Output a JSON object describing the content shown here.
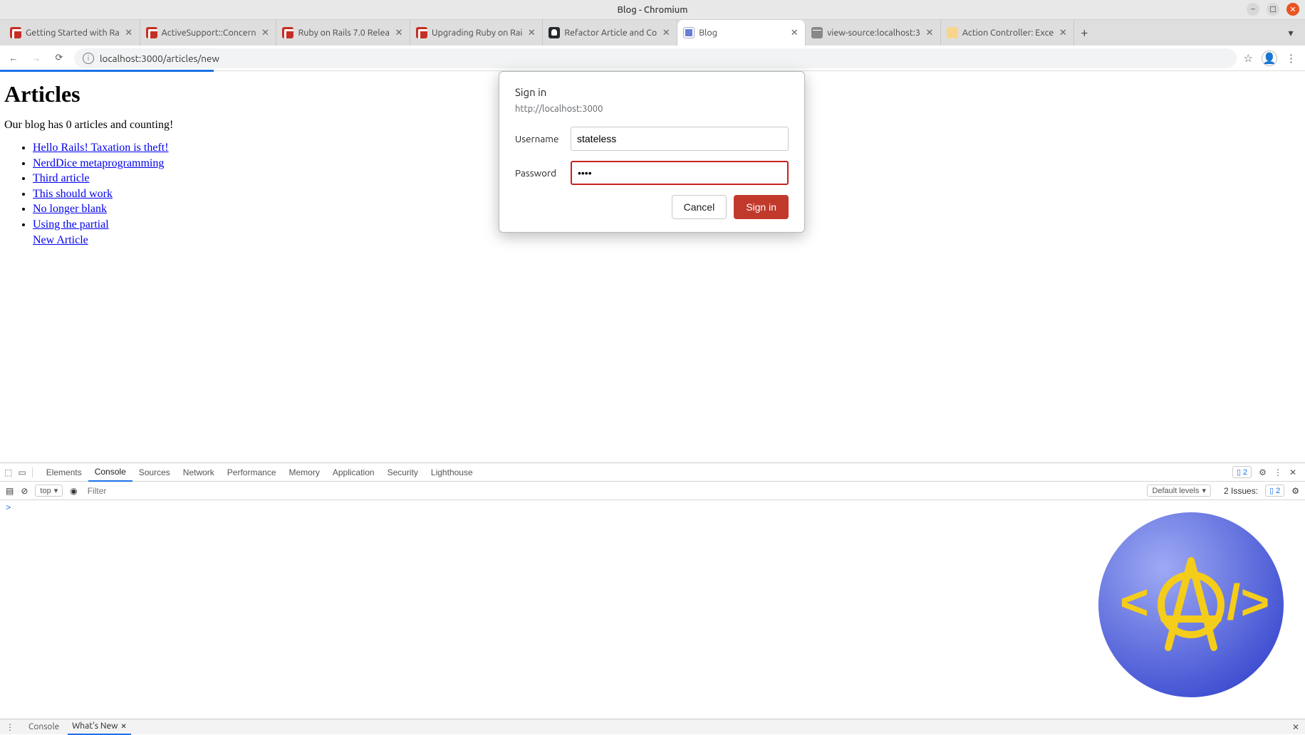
{
  "os": {
    "title": "Blog - Chromium"
  },
  "tabs": [
    {
      "title": "Getting Started with Ra",
      "favicon": "rails"
    },
    {
      "title": "ActiveSupport::Concern",
      "favicon": "rails"
    },
    {
      "title": "Ruby on Rails 7.0 Relea",
      "favicon": "rails"
    },
    {
      "title": "Upgrading Ruby on Rai",
      "favicon": "rails"
    },
    {
      "title": "Refactor Article and Co",
      "favicon": "github"
    },
    {
      "title": "Blog",
      "favicon": "blog",
      "active": true
    },
    {
      "title": "view-source:localhost:3",
      "favicon": "globe"
    },
    {
      "title": "Action Controller: Exce",
      "favicon": "doc"
    }
  ],
  "address": {
    "url": "localhost:3000/articles/new"
  },
  "page": {
    "heading": "Articles",
    "counting": "Our blog has 0 articles and counting!",
    "articles": [
      "Hello Rails! Taxation is theft!",
      "NerdDice metaprogramming",
      "Third article",
      "This should work",
      "No longer blank",
      "Using the partial"
    ],
    "new_article": "New Article"
  },
  "auth": {
    "title": "Sign in",
    "origin": "http://localhost:3000",
    "username_label": "Username",
    "username_value": "stateless",
    "password_label": "Password",
    "password_value": "••••",
    "cancel": "Cancel",
    "signin": "Sign in"
  },
  "devtools": {
    "panels": [
      "Elements",
      "Console",
      "Sources",
      "Network",
      "Performance",
      "Memory",
      "Application",
      "Security",
      "Lighthouse"
    ],
    "active_panel": "Console",
    "issues_badge": "2",
    "context": "top",
    "filter_placeholder": "Filter",
    "levels": "Default levels",
    "issues_text": "2 Issues:",
    "issues_count": "2",
    "drawer_tabs": [
      "Console",
      "What's New"
    ],
    "drawer_active": "What's New"
  }
}
